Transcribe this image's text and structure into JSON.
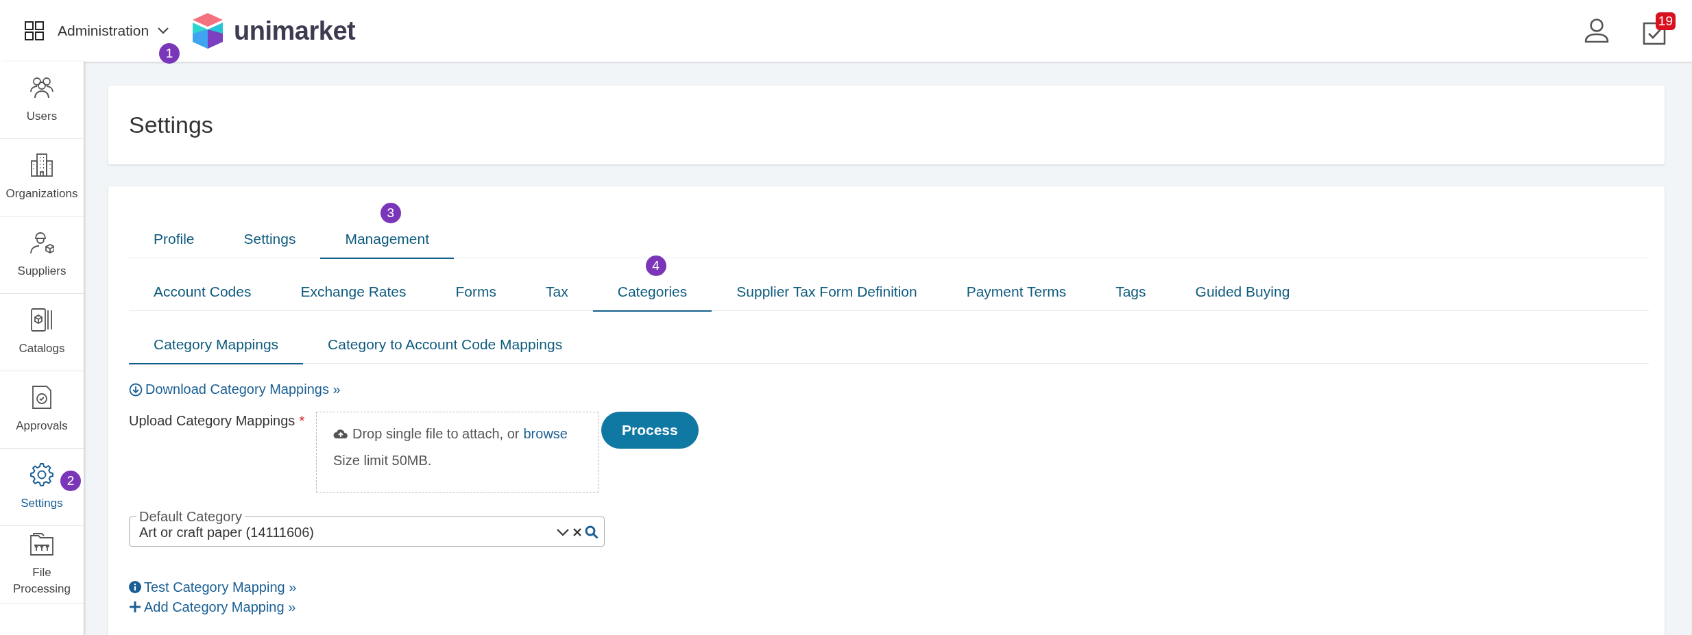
{
  "topbar": {
    "app_menu": {
      "label": "Administration",
      "marker": "1"
    },
    "logo": "unimarket",
    "tasks_badge": "19"
  },
  "sidebar": {
    "items": [
      {
        "label": "Users",
        "selected": false
      },
      {
        "label": "Organizations",
        "selected": false
      },
      {
        "label": "Suppliers",
        "selected": false
      },
      {
        "label": "Catalogs",
        "selected": false
      },
      {
        "label": "Approvals",
        "selected": false
      },
      {
        "label": "Settings",
        "selected": true,
        "marker": "2"
      },
      {
        "label": "File Processing",
        "selected": false
      }
    ]
  },
  "page_title": "Settings",
  "tabs": [
    {
      "label": "Profile",
      "selected": false
    },
    {
      "label": "Settings",
      "selected": false
    },
    {
      "label": "Management",
      "selected": true,
      "marker": "3"
    }
  ],
  "subtabs": [
    {
      "label": "Account Codes",
      "selected": false
    },
    {
      "label": "Exchange Rates",
      "selected": false
    },
    {
      "label": "Forms",
      "selected": false
    },
    {
      "label": "Tax",
      "selected": false
    },
    {
      "label": "Categories",
      "selected": true,
      "marker": "4"
    },
    {
      "label": "Supplier Tax Form Definition",
      "selected": false
    },
    {
      "label": "Payment Terms",
      "selected": false
    },
    {
      "label": "Tags",
      "selected": false
    },
    {
      "label": "Guided Buying",
      "selected": false
    }
  ],
  "section_tabs": [
    {
      "label": "Category Mappings",
      "selected": true
    },
    {
      "label": "Category to Account Code Mappings",
      "selected": false
    }
  ],
  "download_link": "Download Category Mappings »",
  "upload": {
    "label": "Upload Category Mappings",
    "required_mark": "*",
    "drop_text": "Drop single file to attach, or",
    "browse": "browse",
    "size_limit": "Size limit 50MB.",
    "button": "Process"
  },
  "default_category": {
    "label": "Default Category",
    "value": "Art or craft paper (14111606)"
  },
  "links": [
    {
      "kind": "info",
      "label": "Test Category Mapping »"
    },
    {
      "kind": "add",
      "label": "Add Category Mapping »"
    }
  ]
}
